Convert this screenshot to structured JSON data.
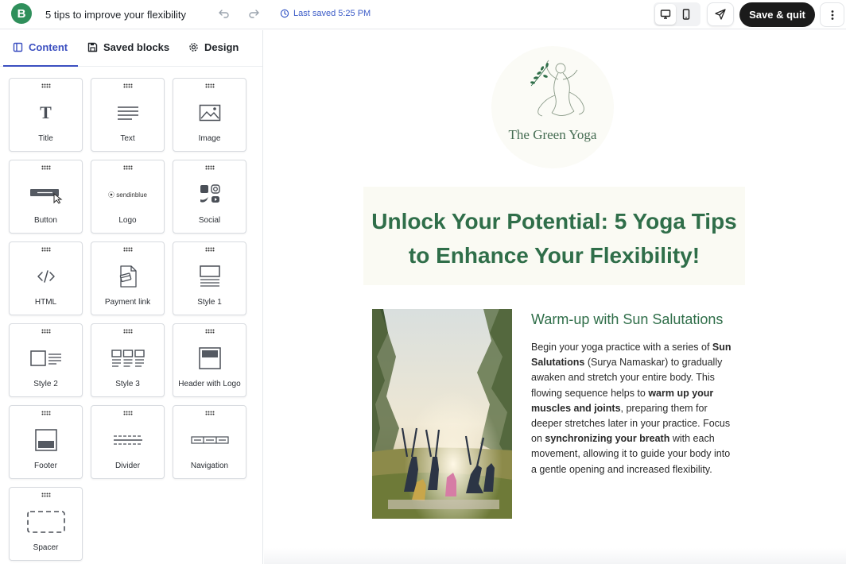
{
  "header": {
    "brand_letter": "B",
    "doc_title": "5 tips to improve your flexibility",
    "last_saved": "Last saved 5:25 PM",
    "save_quit_label": "Save & quit"
  },
  "tabs": [
    {
      "label": "Content",
      "icon": "content-icon",
      "active": true
    },
    {
      "label": "Saved blocks",
      "icon": "save-icon"
    },
    {
      "label": "Design",
      "icon": "gear-icon"
    }
  ],
  "blocks": [
    {
      "label": "Title",
      "icon": "title-icon"
    },
    {
      "label": "Text",
      "icon": "text-icon"
    },
    {
      "label": "Image",
      "icon": "image-icon"
    },
    {
      "label": "Button",
      "icon": "button-icon"
    },
    {
      "label": "Logo",
      "icon": "logo-icon",
      "icon_text": "sendinblue"
    },
    {
      "label": "Social",
      "icon": "social-icon"
    },
    {
      "label": "HTML",
      "icon": "code-icon"
    },
    {
      "label": "Payment link",
      "icon": "payment-icon"
    },
    {
      "label": "Style 1",
      "icon": "style1-icon"
    },
    {
      "label": "Style 2",
      "icon": "style2-icon"
    },
    {
      "label": "Style 3",
      "icon": "style3-icon"
    },
    {
      "label": "Header with Logo",
      "icon": "header-logo-icon"
    },
    {
      "label": "Footer",
      "icon": "footer-icon"
    },
    {
      "label": "Divider",
      "icon": "divider-icon"
    },
    {
      "label": "Navigation",
      "icon": "navigation-icon"
    },
    {
      "label": "Spacer",
      "icon": "spacer-icon"
    }
  ],
  "email": {
    "logo_text": "The Green Yoga",
    "hero_title_line1": "Unlock Your Potential: 5 Yoga Tips",
    "hero_title_line2": "to Enhance Your Flexibility!",
    "section_heading": "Warm-up with Sun Salutations",
    "body": {
      "t1": "Begin your yoga practice with a series of ",
      "b1": "Sun Salutations",
      "t2": " (Surya Namaskar) to gradually awaken and stretch your entire body. This flowing sequence helps to ",
      "b2": "warm up your muscles and joints",
      "t3": ", preparing them for deeper stretches later in your practice. Focus on ",
      "b3": "synchronizing your breath",
      "t4": " with each movement, allowing it to guide your body into a gentle opening and increased flexibility."
    }
  },
  "colors": {
    "brand_green": "#2f8f5b",
    "heading_green": "#2f6e49",
    "tab_active": "#3b4fc0",
    "save_button": "#1b1b1b"
  }
}
